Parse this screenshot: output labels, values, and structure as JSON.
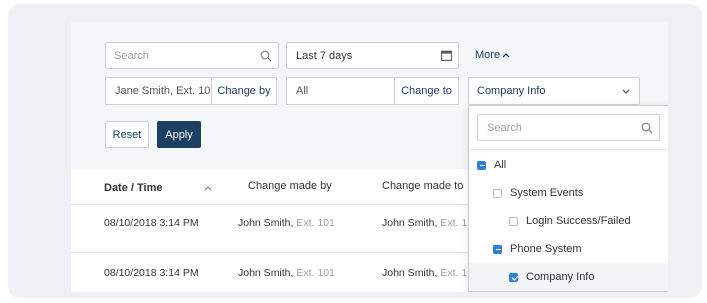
{
  "filters": {
    "search_placeholder": "Search",
    "date_range": "Last 7 days",
    "more_label": "More",
    "changed_by_value": "Jane Smith, Ext. 10",
    "change_by_label": "Change by",
    "changed_to_value": "All",
    "change_to_label": "Change to",
    "category_value": "Company Info",
    "reset_label": "Reset",
    "apply_label": "Apply"
  },
  "table": {
    "headers": {
      "date": "Date / Time",
      "by": "Change made by",
      "to": "Change made to"
    },
    "rows": [
      {
        "date": "08/10/2018 3:14 PM",
        "by_name": "John Smith,",
        "by_ext": "Ext. 101",
        "to_name": "John Smith,",
        "to_ext": "Ext. 1"
      },
      {
        "date": "08/10/2018 3:14 PM",
        "by_name": "John Smith,",
        "by_ext": "Ext. 101",
        "to_name": "John Smith,",
        "to_ext": "Ext. 1"
      }
    ]
  },
  "dropdown": {
    "search_placeholder": "Search",
    "options": [
      {
        "label": "All",
        "state": "partial"
      },
      {
        "label": "System Events",
        "state": "unchecked"
      },
      {
        "label": "Login Success/Failed",
        "state": "unchecked"
      },
      {
        "label": "Phone System",
        "state": "partial"
      },
      {
        "label": "Company Info",
        "state": "checked"
      }
    ]
  },
  "colors": {
    "primary_button": "#1d3f63",
    "checkbox_blue": "#2f7fd6",
    "link": "#1d3f63"
  },
  "icons": [
    "search-icon",
    "calendar-icon",
    "chevron-up-icon",
    "chevron-down-icon",
    "sort-chevron-icon"
  ]
}
